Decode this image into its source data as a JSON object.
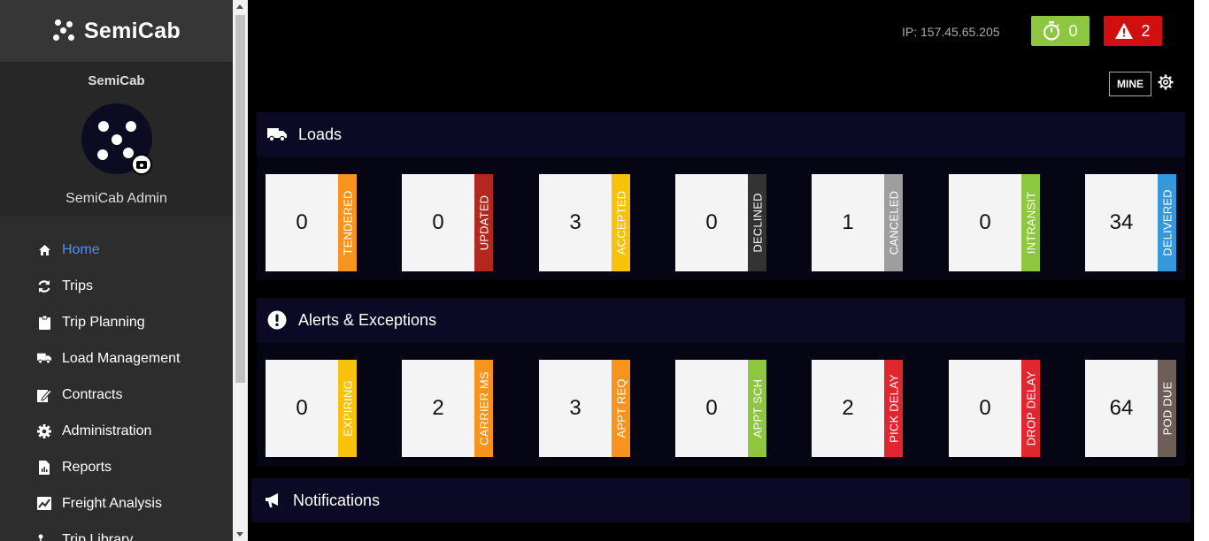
{
  "brand": {
    "name": "SemiCab"
  },
  "profile": {
    "org": "SemiCab",
    "admin": "SemiCab Admin"
  },
  "nav": [
    {
      "label": "Home",
      "icon": "home-icon",
      "active": true
    },
    {
      "label": "Trips",
      "icon": "refresh-icon"
    },
    {
      "label": "Trip Planning",
      "icon": "clipboard-icon"
    },
    {
      "label": "Load Management",
      "icon": "truck-icon"
    },
    {
      "label": "Contracts",
      "icon": "edit-icon"
    },
    {
      "label": "Administration",
      "icon": "gear-icon"
    },
    {
      "label": "Reports",
      "icon": "report-icon"
    },
    {
      "label": "Freight Analysis",
      "icon": "chart-icon"
    },
    {
      "label": "Trip Library",
      "icon": "library-icon"
    }
  ],
  "header": {
    "ip": "IP: 157.45.65.205",
    "timer_count": "0",
    "alert_count": "2",
    "mine_label": "MINE",
    "colors": {
      "green": "#8dc63f",
      "red": "#d20f0f"
    }
  },
  "loads": {
    "title": "Loads",
    "cards": [
      {
        "value": "0",
        "label": "TENDERED",
        "color": "#f7941d"
      },
      {
        "value": "0",
        "label": "UPDATED",
        "color": "#b0281f"
      },
      {
        "value": "3",
        "label": "ACCEPTED",
        "color": "#f9c20a"
      },
      {
        "value": "0",
        "label": "DECLINED",
        "color": "#333333"
      },
      {
        "value": "1",
        "label": "CANCELED",
        "color": "#9e9e9e"
      },
      {
        "value": "0",
        "label": "INTRANSIT",
        "color": "#8dc63f"
      },
      {
        "value": "34",
        "label": "DELIVERED",
        "color": "#3498db"
      }
    ]
  },
  "alerts": {
    "title": "Alerts & Exceptions",
    "cards": [
      {
        "value": "0",
        "label": "EXPIRING",
        "color": "#f9c20a"
      },
      {
        "value": "2",
        "label": "CARRIER MS",
        "color": "#f7941d"
      },
      {
        "value": "3",
        "label": "APPT REQ",
        "color": "#f7941d"
      },
      {
        "value": "0",
        "label": "APPT SCH",
        "color": "#8dc63f"
      },
      {
        "value": "2",
        "label": "PICK DELAY",
        "color": "#e0262e"
      },
      {
        "value": "0",
        "label": "DROP DELAY",
        "color": "#e0262e"
      },
      {
        "value": "64",
        "label": "POD DUE",
        "color": "#6d5f58"
      }
    ]
  },
  "notifications": {
    "title": "Notifications"
  }
}
